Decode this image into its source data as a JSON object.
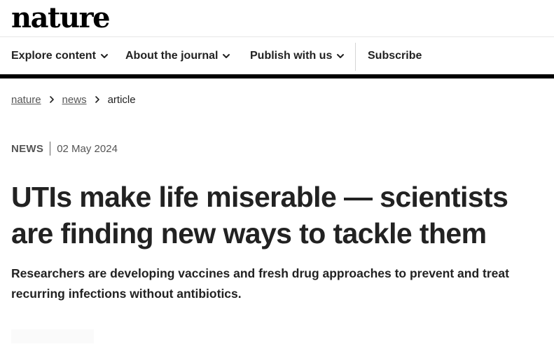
{
  "site": {
    "logo": "nature"
  },
  "nav": {
    "items": [
      {
        "label": "Explore content",
        "has_dropdown": true
      },
      {
        "label": "About the journal",
        "has_dropdown": true
      },
      {
        "label": "Publish with us",
        "has_dropdown": true
      },
      {
        "label": "Subscribe",
        "has_dropdown": false
      }
    ]
  },
  "breadcrumb": {
    "items": [
      "nature",
      "news"
    ],
    "current": "article"
  },
  "article": {
    "type": "NEWS",
    "date": "02 May 2024",
    "title_line1": "UTIs make life miserable — scientists",
    "title_line2": "are finding new ways to tackle them",
    "standfirst_line1": "Researchers are developing vaccines and fresh drug approaches to prevent and treat",
    "standfirst_line2": "recurring infections without antibiotics."
  },
  "icons": {
    "dropdown": "chevron-down-icon",
    "breadcrumb_separator": "chevron-right-icon"
  },
  "colors": {
    "text": "#222222",
    "muted": "#555555",
    "rule": "#000000",
    "border": "#e6e6e6"
  }
}
